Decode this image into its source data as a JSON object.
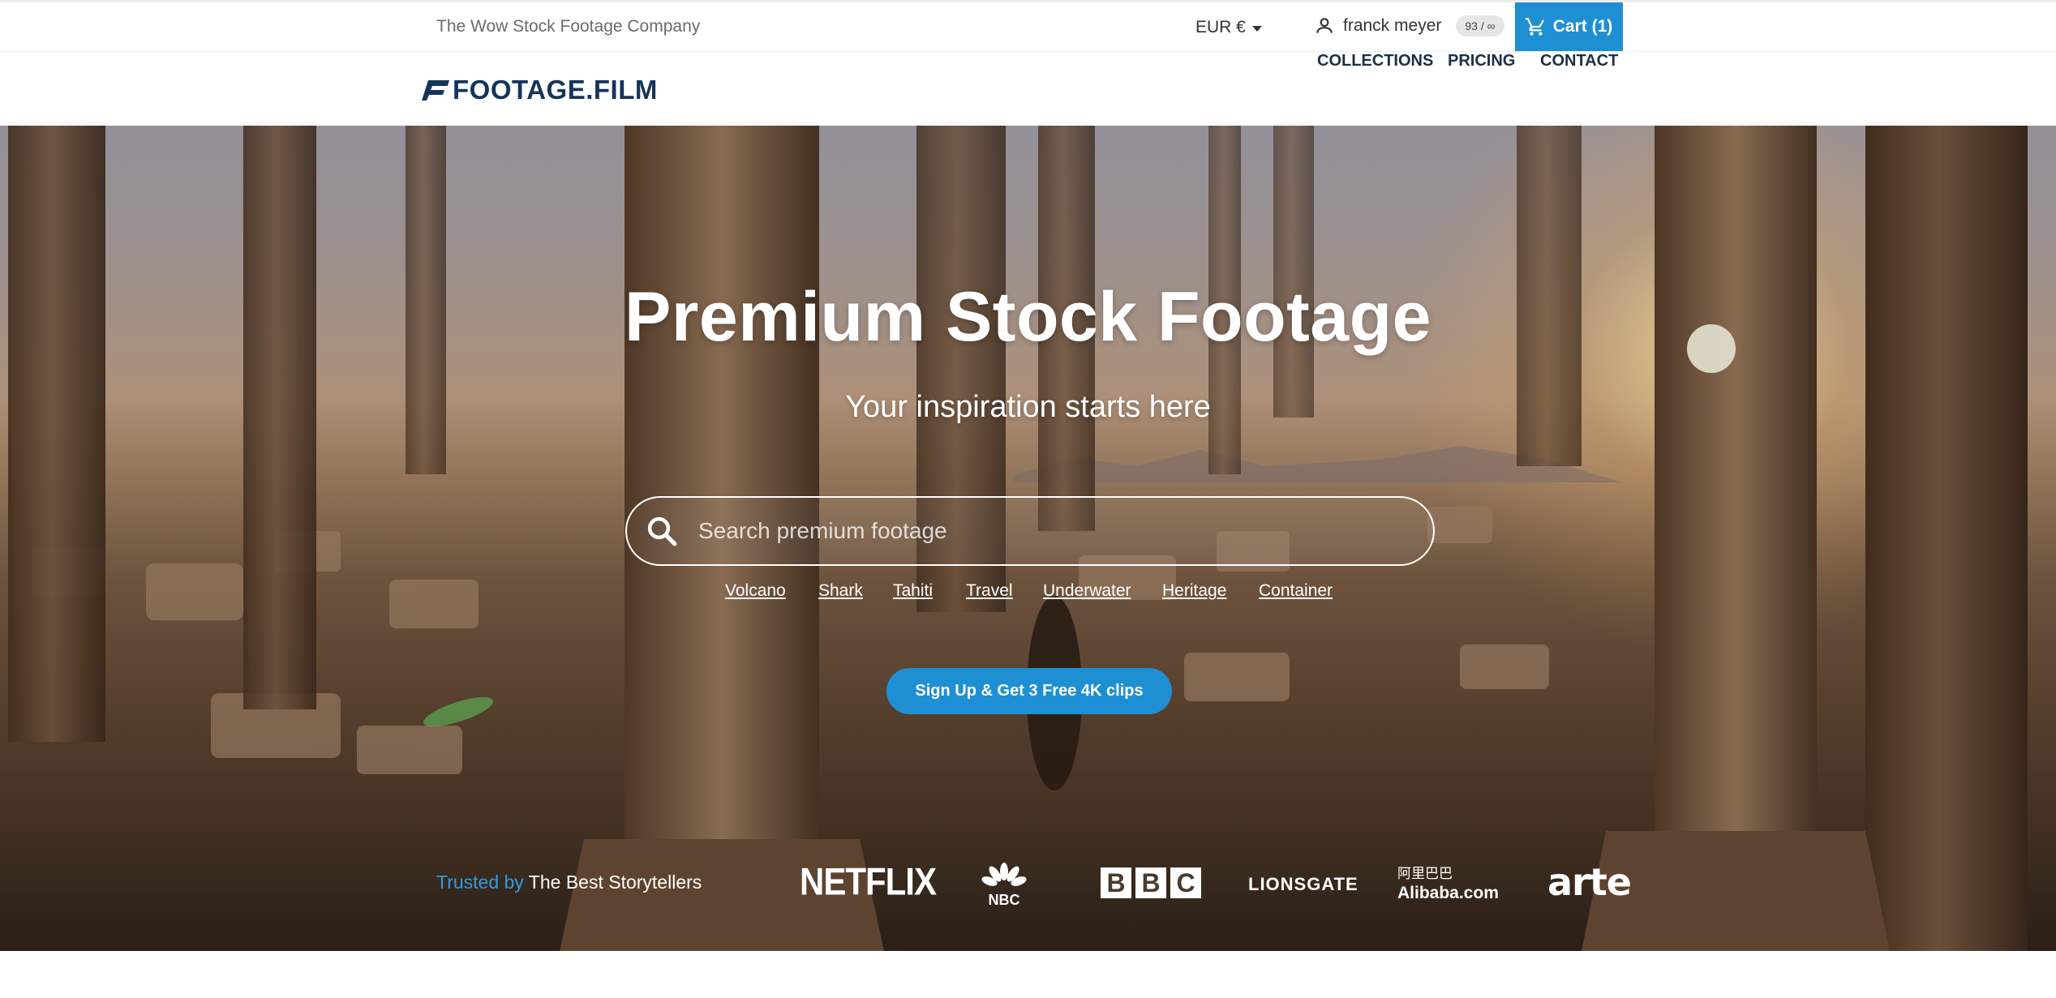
{
  "topbar": {
    "tagline": "The Wow Stock Footage Company",
    "currency": "EUR €",
    "user_name": "franck meyer",
    "credits": "93 / ∞",
    "cart_label": "Cart (1)"
  },
  "brand": {
    "logo_text": "FOOTAGE.FILM"
  },
  "nav": {
    "items": [
      {
        "label": "COLLECTIONS"
      },
      {
        "label": "PRICING"
      },
      {
        "label": "CONTACT"
      }
    ]
  },
  "hero": {
    "title": "Premium Stock Footage",
    "subtitle": "Your inspiration starts here",
    "search_placeholder": "Search premium footage",
    "tags": [
      "Volcano",
      "Shark",
      "Tahiti",
      "Travel",
      "Underwater",
      "Heritage",
      "Container"
    ],
    "cta_label": "Sign Up & Get 3 Free 4K clips"
  },
  "trusted": {
    "highlight": "Trusted by",
    "rest": "The Best Storytellers",
    "logos": {
      "netflix": "NETFLIX",
      "nbc": "NBC",
      "bbc": [
        "B",
        "B",
        "C"
      ],
      "lionsgate": "LIONSGATE",
      "alibaba_zh": "阿里巴巴",
      "alibaba_en": "Alibaba.com",
      "arte": "arte"
    }
  },
  "colors": {
    "accent": "#1f8fd3",
    "logo": "#15345a",
    "trusted_highlight": "#2f9be0"
  },
  "icons": {
    "user": "person-icon",
    "cart": "shopping-cart-icon",
    "search": "magnifier-icon",
    "currency_caret": "caret-down-icon"
  }
}
